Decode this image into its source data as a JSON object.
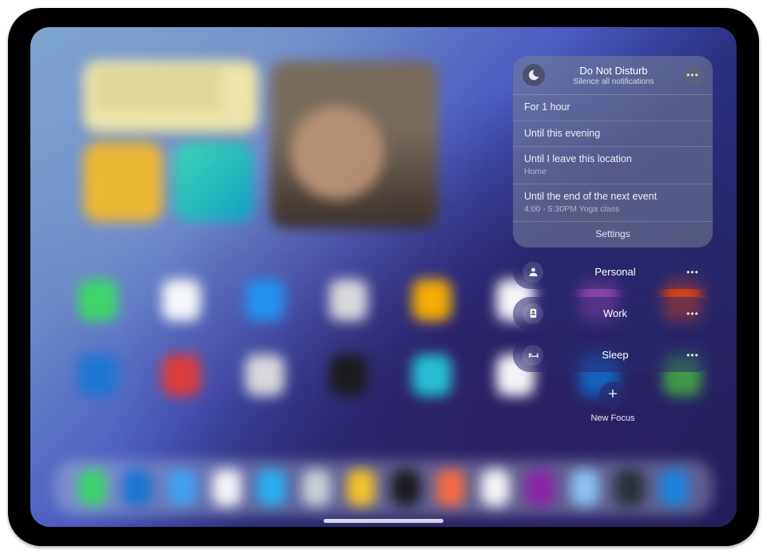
{
  "dnd": {
    "title": "Do Not Disturb",
    "subtitle": "Silence all notifications",
    "options": [
      {
        "primary": "For 1 hour"
      },
      {
        "primary": "Until this evening"
      },
      {
        "primary": "Until I leave this location",
        "secondary": "Home"
      },
      {
        "primary": "Until the end of the next event",
        "secondary": "4:00 - 5:30PM Yoga class"
      }
    ],
    "settings_label": "Settings"
  },
  "focus_modes": [
    {
      "id": "personal",
      "label": "Personal",
      "icon": "person"
    },
    {
      "id": "work",
      "label": "Work",
      "icon": "badge"
    },
    {
      "id": "sleep",
      "label": "Sleep",
      "icon": "bed"
    }
  ],
  "new_focus": {
    "label": "New Focus"
  },
  "colors": {
    "app_row_1": [
      "#3cdc66",
      "#fff",
      "#2196f3",
      "#e0e0e0",
      "#ffb300",
      "#fff",
      "#8e44ad",
      "#d84315"
    ],
    "app_row_2": [
      "#1976d2",
      "#e53935",
      "#e0e0e0",
      "#1b1b1b",
      "#26c6da",
      "#fff",
      "#1565c0",
      "#43a047"
    ],
    "dock": [
      "#3cdc66",
      "#1976d2",
      "#42a5f5",
      "#fff",
      "#29b6f6",
      "#cfd8dc",
      "#ffca28",
      "#1b1b1b",
      "#ff7043",
      "#fff",
      "#8e24aa",
      "#90caf9",
      "#263238",
      "#1e88e5"
    ]
  }
}
